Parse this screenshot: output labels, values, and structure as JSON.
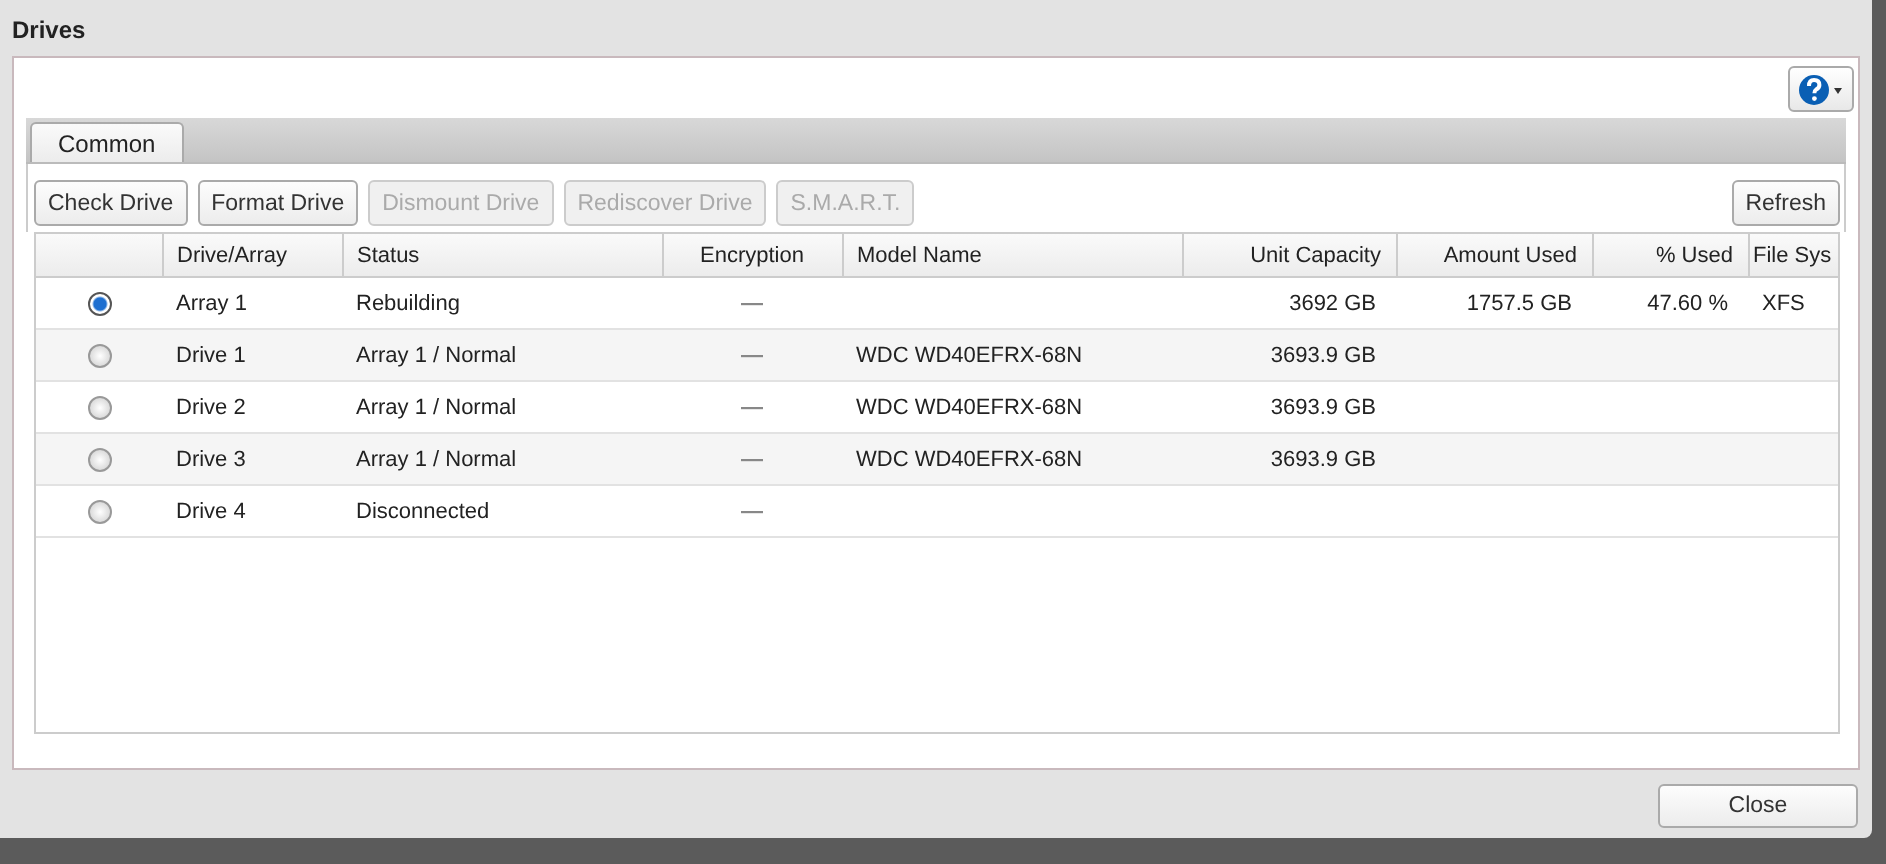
{
  "window": {
    "title": "Drives"
  },
  "tabs": [
    {
      "label": "Common",
      "selected": true
    }
  ],
  "toolbar": [
    {
      "label": "Check Drive",
      "disabled": false
    },
    {
      "label": "Format Drive",
      "disabled": false
    },
    {
      "label": "Dismount Drive",
      "disabled": true
    },
    {
      "label": "Rediscover Drive",
      "disabled": true
    },
    {
      "label": "S.M.A.R.T.",
      "disabled": true
    }
  ],
  "refresh_button": "Refresh",
  "table": {
    "columns": [
      "Drive/Array",
      "Status",
      "Encryption",
      "Model Name",
      "Unit Capacity",
      "Amount Used",
      "% Used",
      "File Sys"
    ],
    "rows": [
      {
        "selected": true,
        "cells": [
          "Array 1",
          "Rebuilding",
          "—",
          "",
          "3692 GB",
          "1757.5 GB",
          "47.60 %",
          "XFS"
        ]
      },
      {
        "selected": false,
        "cells": [
          "Drive 1",
          "Array 1 / Normal",
          "—",
          "WDC WD40EFRX-68N",
          "3693.9 GB",
          "",
          "",
          ""
        ]
      },
      {
        "selected": false,
        "cells": [
          "Drive 2",
          "Array 1 / Normal",
          "—",
          "WDC WD40EFRX-68N",
          "3693.9 GB",
          "",
          "",
          ""
        ]
      },
      {
        "selected": false,
        "cells": [
          "Drive 3",
          "Array 1 / Normal",
          "—",
          "WDC WD40EFRX-68N",
          "3693.9 GB",
          "",
          "",
          ""
        ]
      },
      {
        "selected": false,
        "cells": [
          "Drive 4",
          "Disconnected",
          "—",
          "",
          "",
          "",
          "",
          ""
        ]
      }
    ]
  },
  "close_button": "Close"
}
